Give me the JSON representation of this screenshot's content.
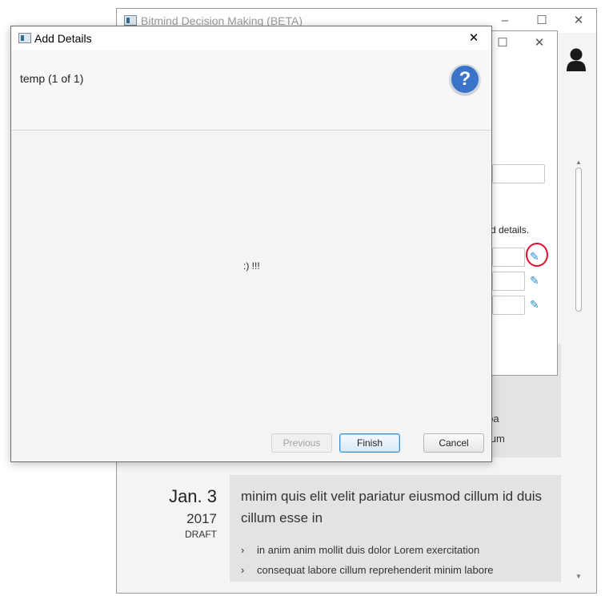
{
  "main_window": {
    "title": "Bitmind Decision Making (BETA)",
    "minimize": "–",
    "maximize": "☐",
    "close": "✕"
  },
  "middle_window": {
    "maximize": "☐",
    "close": "✕",
    "details_hint": "d details.",
    "pencil": "✎"
  },
  "background_card1": {
    "line1": "ulpa",
    "line2": "psum"
  },
  "entry": {
    "date": "Jan. 3",
    "year": "2017",
    "status": "DRAFT",
    "heading": "minim quis elit velit pariatur eiusmod cillum id duis cillum esse in",
    "bullets": [
      "in anim anim mollit duis dolor Lorem exercitation",
      "consequat labore cillum reprehenderit minim labore"
    ],
    "chevron": "›"
  },
  "dialog": {
    "title": "Add Details",
    "close": "✕",
    "step_label": "temp (1 of 1)",
    "help": "?",
    "content_text": ":) !!!",
    "previous_label": "Previous",
    "finish_label": "Finish",
    "cancel_label": "Cancel"
  },
  "colors": {
    "accent": "#3a73c8",
    "pencil": "#2a8fd6",
    "annotation": "#e0102a"
  }
}
